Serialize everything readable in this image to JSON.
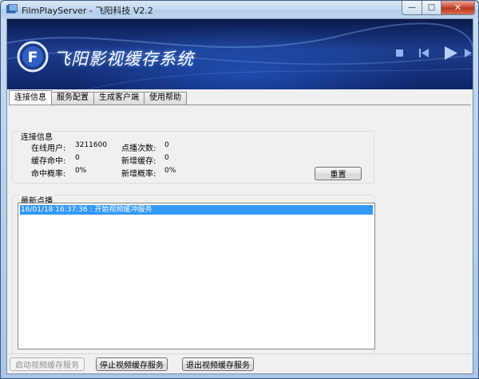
{
  "window": {
    "title": "FilmPlayServer - 飞阳科技 V2.2",
    "controls": {
      "minimize": "—",
      "maximize": "□",
      "close": "✕"
    }
  },
  "banner": {
    "logo_letter": "F",
    "title": "飞阳影视缓存系统",
    "media_icons": [
      "stop-icon",
      "previous-icon",
      "play-icon",
      "next-icon"
    ]
  },
  "tabs": [
    {
      "label": "连接信息",
      "active": true
    },
    {
      "label": "服务配置",
      "active": false
    },
    {
      "label": "生成客户端",
      "active": false
    },
    {
      "label": "使用帮助",
      "active": false
    }
  ],
  "connection": {
    "group_label": "连接信息",
    "online_users_label": "在线用户:",
    "online_users_value": "3211600",
    "play_count_label": "点播次数:",
    "play_count_value": "0",
    "cache_hit_label": "缓存命中:",
    "cache_hit_value": "0",
    "new_cache_label": "新增缓存:",
    "new_cache_value": "0",
    "hit_rate_label": "命中概率:",
    "hit_rate_value": "0%",
    "new_rate_label": "新增概率:",
    "new_rate_value": "0%",
    "reset_button": "重置"
  },
  "latest": {
    "group_label": "最新点播",
    "log": [
      "16/01/18 16:37:36 : 开始视频缓冲服务"
    ]
  },
  "footer": {
    "start_button": "启动视频缓存服务",
    "stop_button": "停止视频缓存服务",
    "exit_button": "退出视频缓存服务"
  },
  "colors": {
    "selection": "#3399ff",
    "banner_dark": "#0b1a4f",
    "banner_mid": "#1c3d8c"
  }
}
